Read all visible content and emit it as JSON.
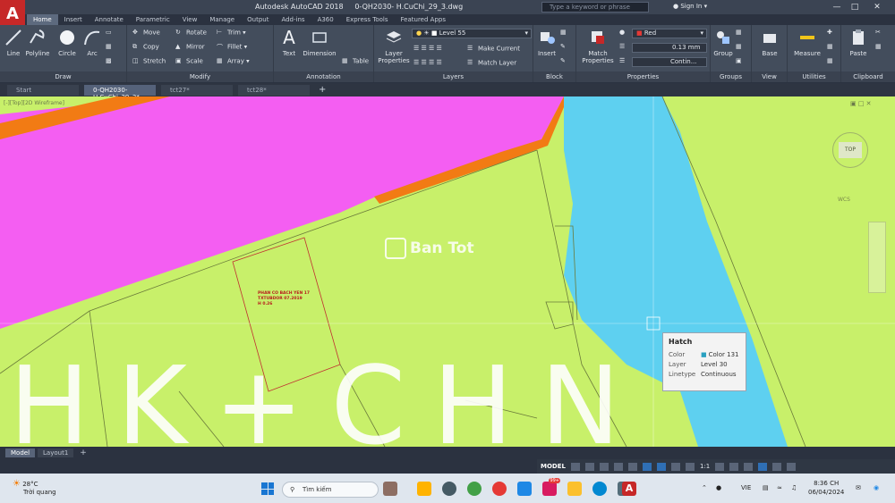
{
  "window": {
    "app_name": "Autodesk AutoCAD 2018",
    "file_name": "0-QH2030- H.CuChi_29_3.dwg",
    "search_placeholder": "Type a keyword or phrase",
    "signin_label": "Sign In"
  },
  "ribbon_tabs": [
    "Home",
    "Insert",
    "Annotate",
    "Parametric",
    "View",
    "Manage",
    "Output",
    "Add-ins",
    "A360",
    "Express Tools",
    "Featured Apps"
  ],
  "ribbon": {
    "draw": {
      "title": "Draw",
      "line": "Line",
      "polyline": "Polyline",
      "circle": "Circle",
      "arc": "Arc"
    },
    "modify": {
      "title": "Modify",
      "move": "Move",
      "rotate": "Rotate",
      "trim": "Trim",
      "copy": "Copy",
      "mirror": "Mirror",
      "fillet": "Fillet",
      "stretch": "Stretch",
      "scale": "Scale",
      "array": "Array"
    },
    "annotation": {
      "title": "Annotation",
      "text": "Text",
      "dimension": "Dimension",
      "table": "Table"
    },
    "layers": {
      "title": "Layers",
      "layer_properties": "Layer Properties",
      "current_layer": "Level 55",
      "make_current": "Make Current",
      "match_layer": "Match Layer"
    },
    "block": {
      "title": "Block",
      "insert": "Insert"
    },
    "properties": {
      "title": "Properties",
      "match_properties": "Match Properties",
      "color": "Red",
      "lineweight": "0.13 mm",
      "linetype": "Contin..."
    },
    "groups": {
      "title": "Groups",
      "group": "Group"
    },
    "view": {
      "title": "View",
      "base": "Base"
    },
    "utilities": {
      "title": "Utilities",
      "measure": "Measure"
    },
    "clipboard": {
      "title": "Clipboard",
      "paste": "Paste"
    }
  },
  "doc_tabs": [
    "Start",
    "0-QH2030- H.CuChi_29_3*",
    "tct27*",
    "tct28*"
  ],
  "canvas": {
    "viewport_label": "[-][Top][2D Wireframe]",
    "parcel_text_1": "PHAN CO BACH YEN 17",
    "parcel_text_2": "TXTUBDOR 07.2019",
    "parcel_text_3": "H 0.26",
    "watermark": "Ban Tot",
    "big_letters": "HK+CHN",
    "viewcube_label": "TOP",
    "wcs_label": "WCS"
  },
  "tooltip": {
    "title": "Hatch",
    "rows": [
      {
        "key": "Color",
        "value": "Color 131"
      },
      {
        "key": "Layer",
        "value": "Level 30"
      },
      {
        "key": "Linetype",
        "value": "Continuous"
      }
    ]
  },
  "layout_tabs": [
    "Model",
    "Layout1"
  ],
  "status": {
    "model": "MODEL",
    "scale": "1:1"
  },
  "taskbar": {
    "temperature": "28°C",
    "weather": "Trời quang",
    "search": "Tìm kiếm",
    "language": "VIE",
    "time": "8:36 CH",
    "date": "06/04/2024",
    "badge": "99+"
  },
  "colors": {
    "ribbon_bg": "#434d5c",
    "canvas_green": "#c8f06a",
    "magenta": "#f45ef2",
    "river_blue": "#5ed0f0",
    "road_orange": "#f27b14",
    "autocad_red": "#c62828"
  }
}
